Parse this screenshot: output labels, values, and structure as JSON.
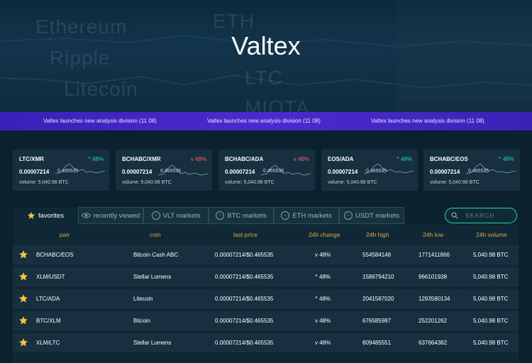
{
  "hero": {
    "title": "Valtex",
    "background_words": [
      "Ethereum",
      "ETH",
      "Ripple",
      "Litecoin",
      "LTC",
      "MIOTA"
    ]
  },
  "ticker": {
    "items": [
      "Valtex launches new analysis division (11 08)",
      "Valtex launches new analysis division (11 08)",
      "Valtex launches new analysis division (11 08)"
    ]
  },
  "cards": [
    {
      "pair": "LTC/XMR",
      "direction": "up",
      "arrow": "^",
      "change": "48%",
      "btc": "0.00007214",
      "usd": "0.465535",
      "volume": "volume: 5,040.98 BTC"
    },
    {
      "pair": "BCHABC/XMR",
      "direction": "down",
      "arrow": "v",
      "change": "48%",
      "btc": "0.00007214",
      "usd": "0.465535",
      "volume": "volume: 5,040.98 BTC"
    },
    {
      "pair": "BCHABC/ADA",
      "direction": "down",
      "arrow": "v",
      "change": "48%",
      "btc": "0.00007214",
      "usd": "0.465535",
      "volume": "volume: 5,040.98 BTC"
    },
    {
      "pair": "EOS/ADA",
      "direction": "up",
      "arrow": "^",
      "change": "48%",
      "btc": "0.00007214",
      "usd": "0.465535",
      "volume": "volume: 5,040.98 BTC"
    },
    {
      "pair": "BCHABC/EOS",
      "direction": "up",
      "arrow": "^",
      "change": "48%",
      "btc": "0.00007214",
      "usd": "0.465535",
      "volume": "volume: 5,040.98 BTC"
    }
  ],
  "tabs": [
    {
      "label": "favorites",
      "icon": "star-icon",
      "active": true
    },
    {
      "label": "recently viewed",
      "icon": "eye-icon",
      "active": false
    },
    {
      "label": "VLT markets",
      "icon": "chart-line-icon",
      "active": false
    },
    {
      "label": "BTC markets",
      "icon": "chart-line-icon",
      "active": false
    },
    {
      "label": "ETH markets",
      "icon": "chart-line-icon",
      "active": false
    },
    {
      "label": "USDT markets",
      "icon": "chart-line-icon",
      "active": false
    }
  ],
  "search": {
    "placeholder": "SEARCH"
  },
  "table": {
    "headers": [
      "pair",
      "coin",
      "last price",
      "24h change",
      "24h high",
      "24h low",
      "24h volume"
    ],
    "rows": [
      {
        "pair": "BCHABC/EOS",
        "coin": "Bitcoin Cash ABC",
        "last_price": "0.00007214/$0.465535",
        "direction": "down",
        "arrow": "v",
        "change": "48%",
        "high": "554584148",
        "low": "1771411866",
        "volume": "5,040.98 BTC"
      },
      {
        "pair": "XLM/USDT",
        "coin": "Stellar Lumens",
        "last_price": "0.00007214/$0.465535",
        "direction": "up",
        "arrow": "^",
        "change": "48%",
        "high": "1586794210",
        "low": "966101938",
        "volume": "5,040.98 BTC"
      },
      {
        "pair": "LTC/ADA",
        "coin": "Litecoin",
        "last_price": "0.00007214/$0.465535",
        "direction": "up",
        "arrow": "^",
        "change": "48%",
        "high": "2041587020",
        "low": "1293580134",
        "volume": "5,040.98 BTC"
      },
      {
        "pair": "BTC/XLM",
        "coin": "Bitcoin",
        "last_price": "0.00007214/$0.465535",
        "direction": "down",
        "arrow": "v",
        "change": "48%",
        "high": "676585987",
        "low": "252201262",
        "volume": "5,040.98 BTC"
      },
      {
        "pair": "XLM/LTC",
        "coin": "Stellar Lumens",
        "last_price": "0.00007214/$0.465535",
        "direction": "down",
        "arrow": "v",
        "change": "48%",
        "high": "809485551",
        "low": "637664382",
        "volume": "5,040.98 BTC"
      }
    ]
  },
  "colors": {
    "accent": "#1fd9b0",
    "down": "#f0646b",
    "header_text": "#e3a64a",
    "star": "#f5c242",
    "ticker": "#4b2bd0"
  }
}
